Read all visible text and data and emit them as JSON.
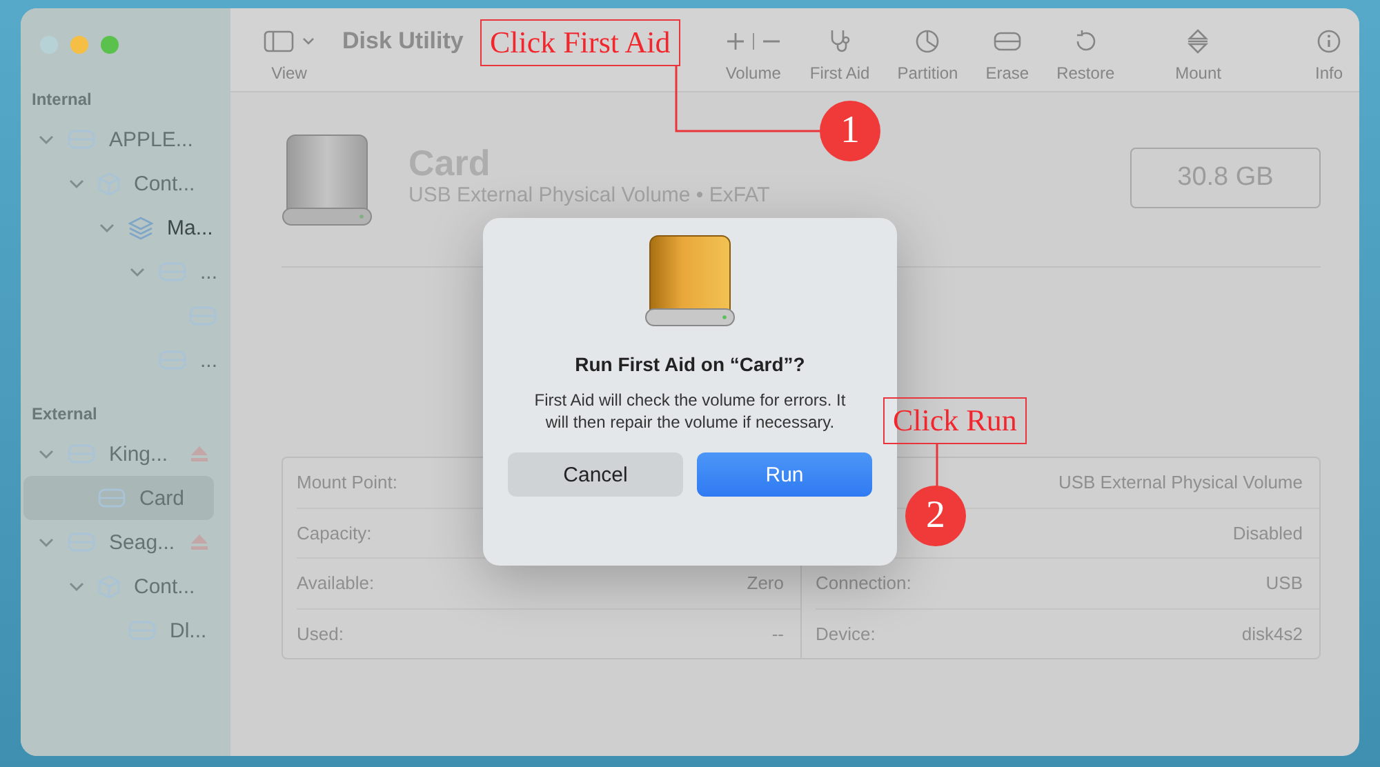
{
  "window": {
    "traffic_lights": true
  },
  "toolbar": {
    "view_label": "View",
    "title": "Disk Utility",
    "buttons": [
      {
        "kind": "volume",
        "label": "Volume"
      },
      {
        "kind": "first-aid",
        "label": "First Aid"
      },
      {
        "kind": "partition",
        "label": "Partition"
      },
      {
        "kind": "erase",
        "label": "Erase"
      },
      {
        "kind": "restore",
        "label": "Restore"
      },
      {
        "kind": "mount",
        "label": "Mount"
      },
      {
        "kind": "info",
        "label": "Info"
      }
    ]
  },
  "sidebar": {
    "sections": [
      {
        "heading": "Internal",
        "items": [
          {
            "kind": "disk",
            "label": "APPLE...",
            "selected": false,
            "dimmed": true,
            "ejectable": false,
            "expanded": true,
            "children": [
              {
                "kind": "container",
                "label": "Cont...",
                "selected": false,
                "dimmed": true,
                "expanded": true,
                "children": [
                  {
                    "kind": "volume",
                    "label": "Ma...",
                    "selected": false,
                    "dimmed": false,
                    "expanded": true,
                    "children": [
                      {
                        "kind": "disk",
                        "label": "...",
                        "selected": false,
                        "dimmed": true,
                        "expanded": true,
                        "children": [
                          {
                            "kind": "disk",
                            "selected": false,
                            "dimmed": true
                          }
                        ]
                      },
                      {
                        "kind": "disk",
                        "label": "...",
                        "selected": false,
                        "dimmed": true
                      }
                    ]
                  }
                ]
              }
            ]
          }
        ]
      },
      {
        "heading": "External",
        "items": [
          {
            "kind": "disk",
            "label": "King...",
            "selected": false,
            "dimmed": true,
            "ejectable": true,
            "expanded": true,
            "children": [
              {
                "kind": "disk",
                "label": "Card",
                "selected": true,
                "dimmed": true
              }
            ]
          },
          {
            "kind": "disk",
            "label": "Seag...",
            "selected": false,
            "dimmed": true,
            "ejectable": true,
            "expanded": true,
            "children": [
              {
                "kind": "container",
                "label": "Cont...",
                "selected": false,
                "dimmed": true,
                "expanded": true,
                "children": [
                  {
                    "kind": "disk",
                    "label": "Dl...",
                    "selected": false,
                    "dimmed": true
                  }
                ]
              }
            ]
          }
        ]
      }
    ]
  },
  "volume": {
    "name": "Card",
    "subtitle": "USB External Physical Volume • ExFAT",
    "capacity": "30.8 GB"
  },
  "details_left": [
    {
      "label": "Mount Point:"
    },
    {
      "label": "Capacity:"
    },
    {
      "label": "Available:",
      "value": "Zero"
    },
    {
      "label": "Used:",
      "value": "--"
    }
  ],
  "details_right": [
    {
      "value": "USB External Physical Volume"
    },
    {
      "value": "Disabled"
    },
    {
      "label": "Connection:",
      "value": "USB"
    },
    {
      "label": "Device:",
      "value": "disk4s2"
    }
  ],
  "dialog": {
    "title": "Run First Aid on “Card”?",
    "message": "First Aid will check the volume for errors. It will then repair the volume if necessary.",
    "buttons": [
      {
        "label": "Cancel",
        "primary": false
      },
      {
        "label": "Run",
        "primary": true
      }
    ]
  },
  "annotations": [
    {
      "text": "Click First Aid",
      "number": "1"
    },
    {
      "text": "Click Run",
      "number": "2"
    }
  ]
}
